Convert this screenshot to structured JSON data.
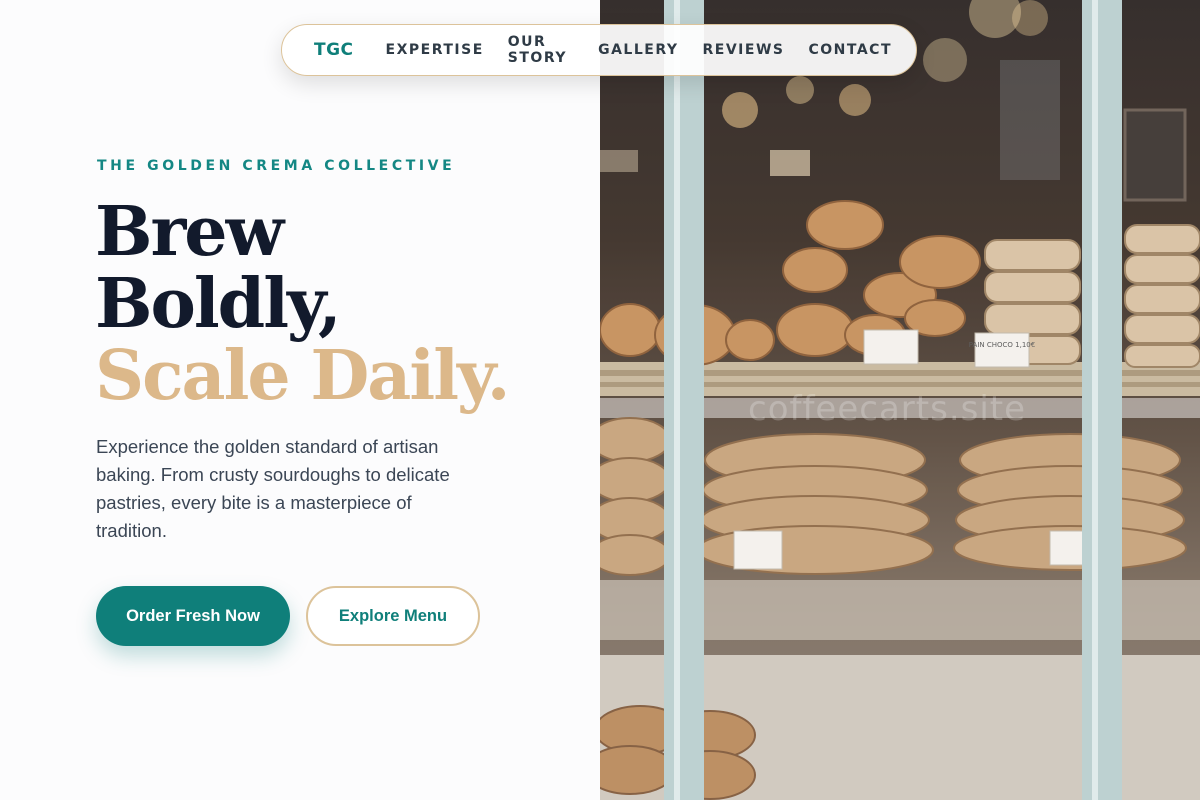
{
  "nav": {
    "logo": "TGC",
    "links": [
      "EXPERTISE",
      "OUR STORY",
      "GALLERY",
      "REVIEWS",
      "CONTACT"
    ]
  },
  "hero": {
    "eyebrow": "THE GOLDEN CREMA COLLECTIVE",
    "headline_line1": "Brew",
    "headline_line2": "Boldly,",
    "headline_line3": "Scale Daily.",
    "description": "Experience the golden standard of artisan baking. From crusty sourdoughs to delicate pastries, every bite is a masterpiece of tradition.",
    "primary_cta": "Order Fresh Now",
    "secondary_cta": "Explore Menu"
  },
  "photo": {
    "watermark": "coffeecarts.site",
    "price_tag_left": "",
    "price_tag_right": "PAIN CHOCO 1,10€"
  },
  "colors": {
    "accent": "#0f7f7a",
    "gold": "#dcb88a",
    "heading": "#121a2c",
    "body_text": "#3b4655"
  }
}
